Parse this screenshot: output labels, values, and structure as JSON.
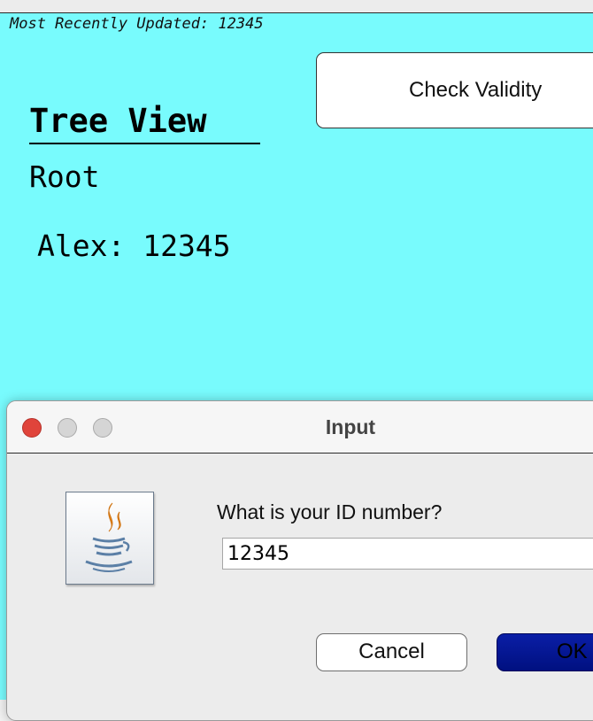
{
  "app": {
    "status_text": "Most Recently Updated: 12345",
    "check_button_label": "Check Validity",
    "tree_title": "Tree View",
    "tree_root": "Root",
    "tree_node": "Alex: 12345",
    "background_color": "#78fbfd"
  },
  "dialog": {
    "title": "Input",
    "icon": "java-icon",
    "prompt": "What is your ID number?",
    "input_value": "12345",
    "cancel_label": "Cancel",
    "ok_label": "OK",
    "ok_color": "#0a1ea6"
  }
}
